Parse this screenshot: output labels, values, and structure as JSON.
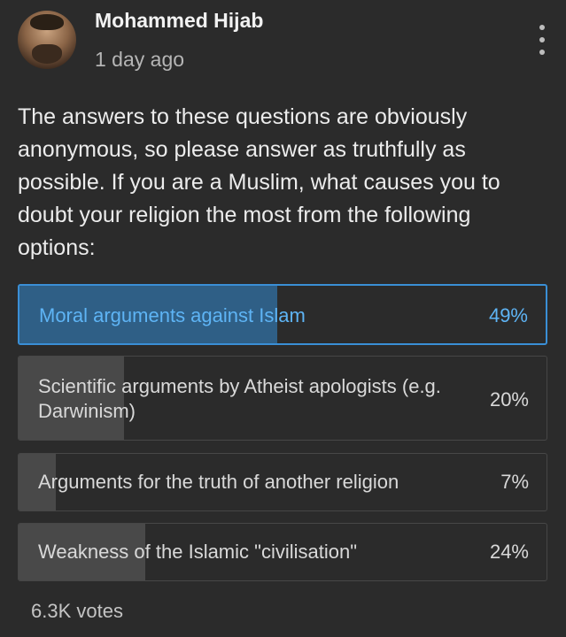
{
  "post": {
    "author": "Mohammed Hijab",
    "time": "1 day ago",
    "text": "The answers to these questions are obviously anonymous, so please answer as truthfully as possible. If you are a Muslim, what causes you to doubt your religion the most from the following options:"
  },
  "poll": {
    "options": [
      {
        "label": "Moral arguments against Islam",
        "percent_label": "49%",
        "percent": 49,
        "selected": true
      },
      {
        "label": "Scientific arguments by Atheist apologists (e.g. Darwinism)",
        "percent_label": "20%",
        "percent": 20,
        "selected": false
      },
      {
        "label": "Arguments for the truth of another religion",
        "percent_label": "7%",
        "percent": 7,
        "selected": false
      },
      {
        "label": "Weakness of the Islamic \"civilisation\"",
        "percent_label": "24%",
        "percent": 24,
        "selected": false
      }
    ],
    "votes": "6.3K votes"
  },
  "icons": {
    "menu": "more-vertical-icon"
  },
  "colors": {
    "accent": "#3a8fd6",
    "accent_text": "#5eb4f5",
    "background": "#2b2b2b"
  }
}
